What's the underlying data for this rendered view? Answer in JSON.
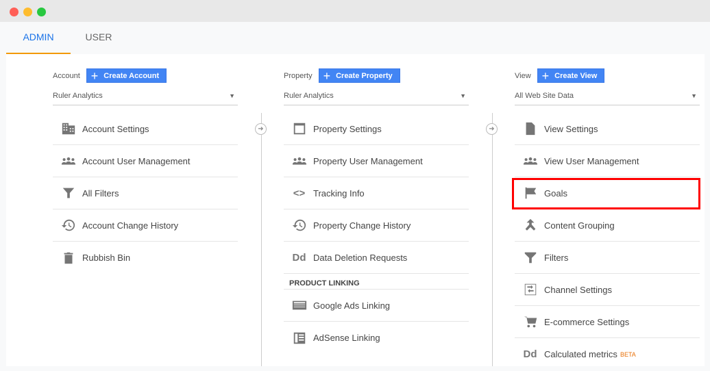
{
  "window": {
    "colors": {
      "close": "#ff5f57",
      "minimize": "#febc2e",
      "maximize": "#28c840"
    }
  },
  "tabs": [
    {
      "label": "ADMIN",
      "active": true
    },
    {
      "label": "USER",
      "active": false
    }
  ],
  "account": {
    "label": "Account",
    "button": "Create Account",
    "dropdown": "Ruler Analytics",
    "items": [
      "Account Settings",
      "Account User Management",
      "All Filters",
      "Account Change History",
      "Rubbish Bin"
    ]
  },
  "property": {
    "label": "Property",
    "button": "Create Property",
    "dropdown": "Ruler Analytics",
    "items": [
      "Property Settings",
      "Property User Management",
      "Tracking Info",
      "Property Change History",
      "Data Deletion Requests"
    ],
    "section": "PRODUCT LINKING",
    "linking": [
      "Google Ads Linking",
      "AdSense Linking"
    ]
  },
  "view": {
    "label": "View",
    "button": "Create View",
    "dropdown": "All Web Site Data",
    "items": [
      "View Settings",
      "View User Management",
      "Goals",
      "Content Grouping",
      "Filters",
      "Channel Settings",
      "E-commerce Settings",
      "Calculated metrics"
    ],
    "beta": "BETA",
    "highlighted": "Goals"
  },
  "icons": {
    "dd": "Dd",
    "plus": "+",
    "caret": "▼",
    "arrow": "➜",
    "code": "<>"
  }
}
